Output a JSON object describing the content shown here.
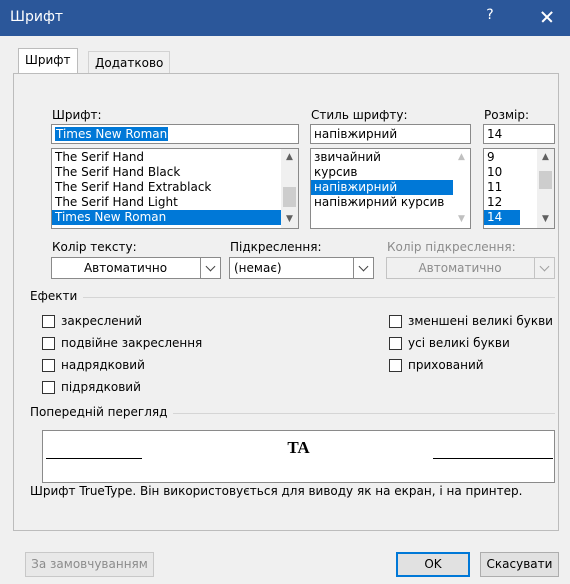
{
  "window": {
    "title": "Шрифт",
    "help_label": "?"
  },
  "tabs": [
    {
      "label": "Шрифт",
      "active": true
    },
    {
      "label": "Додатково",
      "active": false
    }
  ],
  "font": {
    "label": "Шрифт:",
    "value": "Times New Roman",
    "items": [
      "The Serif Hand",
      "The Serif Hand Black",
      "The Serif Hand Extrablack",
      "The Serif Hand Light",
      "Times New Roman"
    ],
    "selected": "Times New Roman"
  },
  "style": {
    "label": "Стиль шрифту:",
    "value": "напівжирний",
    "items": [
      "звичайний",
      "курсив",
      "напівжирний",
      "напівжирний курсив"
    ],
    "selected": "напівжирний"
  },
  "size": {
    "label": "Розмір:",
    "value": "14",
    "items": [
      "9",
      "10",
      "11",
      "12",
      "14"
    ],
    "selected": "14"
  },
  "text_color": {
    "label": "Колір тексту:",
    "value": "Автоматично"
  },
  "underline": {
    "label": "Підкреслення:",
    "value": "(немає)"
  },
  "underline_color": {
    "label": "Колір підкреслення:",
    "value": "Автоматично",
    "disabled": true
  },
  "effects": {
    "label": "Ефекти",
    "left": [
      "закреслений",
      "подвійне закреслення",
      "надрядковий",
      "підрядковий"
    ],
    "right": [
      "зменшені великі букви",
      "усі великі букви",
      "прихований"
    ]
  },
  "preview": {
    "label": "Попередній перегляд",
    "sample": "TA",
    "note": "Шрифт TrueType. Він використовується для виводу як на екран, і на принтер."
  },
  "buttons": {
    "default": "За замовчуванням",
    "ok": "OK",
    "cancel": "Скасувати"
  },
  "colors": {
    "titlebar": "#2b579a",
    "selection": "#0078d7"
  }
}
